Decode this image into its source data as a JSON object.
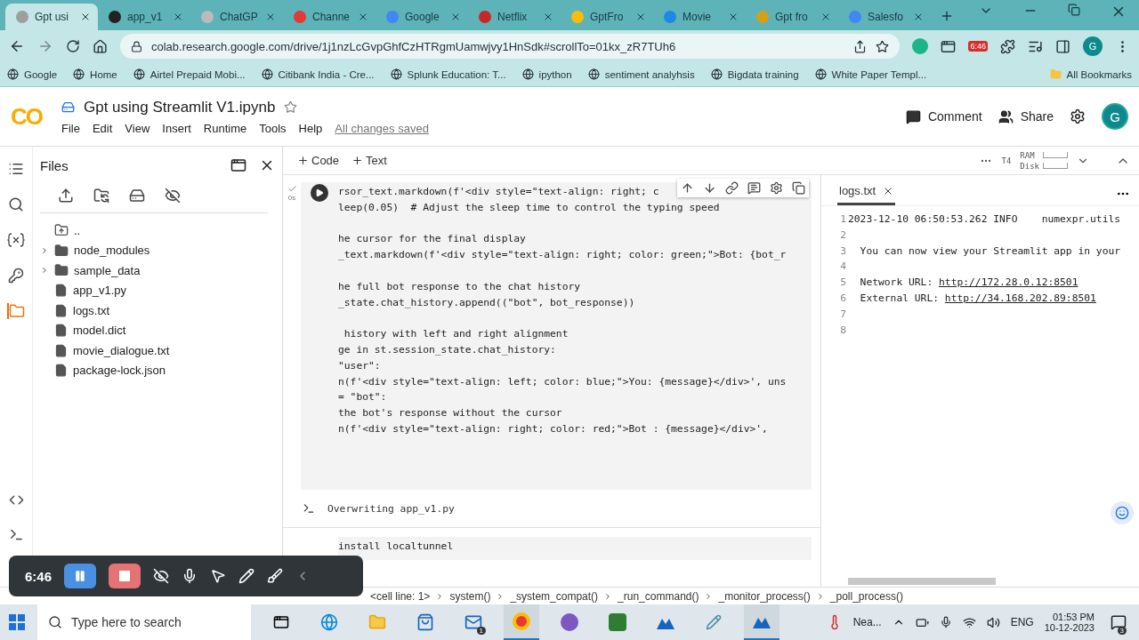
{
  "browser": {
    "tabs": [
      {
        "label": "Gpt usi",
        "selected": true
      },
      {
        "label": "app_v1",
        "selected": false
      },
      {
        "label": "ChatGP",
        "selected": false
      },
      {
        "label": "Channe",
        "selected": false
      },
      {
        "label": "Google",
        "selected": false
      },
      {
        "label": "Netflix",
        "selected": false
      },
      {
        "label": "GptFro",
        "selected": false
      },
      {
        "label": "Movie",
        "selected": false
      },
      {
        "label": "Gpt fro",
        "selected": false
      },
      {
        "label": "Salesfo",
        "selected": false
      }
    ],
    "address": "colab.research.google.com/drive/1j1nzLcGvpGhfCzHTRgmUamwjvy1HnSdk#scrollTo=01kx_zR7TUh6",
    "extension_badge": "6:46",
    "profile_initial": "G",
    "bookmarks": [
      "Google",
      "Home",
      "Airtel Prepaid Mobi...",
      "Citibank India - Cre...",
      "Splunk Education: T...",
      "ipython",
      "sentiment analyhsis",
      "Bigdata training",
      "White Paper Templ..."
    ],
    "all_bookmarks": "All Bookmarks"
  },
  "colab": {
    "logo": "CO",
    "title": "Gpt using Streamlit V1.ipynb",
    "menu": [
      "File",
      "Edit",
      "View",
      "Insert",
      "Runtime",
      "Tools",
      "Help"
    ],
    "save_status": "All changes saved",
    "comment": "Comment",
    "share": "Share",
    "avatar": "G"
  },
  "files_panel": {
    "title": "Files",
    "tree": [
      {
        "name": "..",
        "kind": "up"
      },
      {
        "name": "node_modules",
        "kind": "folder",
        "expanded": false
      },
      {
        "name": "sample_data",
        "kind": "folder",
        "expanded": false
      },
      {
        "name": "app_v1.py",
        "kind": "file"
      },
      {
        "name": "logs.txt",
        "kind": "file"
      },
      {
        "name": "model.dict",
        "kind": "file"
      },
      {
        "name": "movie_dialogue.txt",
        "kind": "file"
      },
      {
        "name": "package-lock.json",
        "kind": "file"
      }
    ]
  },
  "notebook": {
    "add_code": "Code",
    "add_text": "Text",
    "runtime": {
      "gpu": "T4",
      "ram": "RAM",
      "disk": "Disk"
    },
    "cells": [
      {
        "kind": "code",
        "status": "0s",
        "blocks": [
          [
            "rsor_text.markdown(f'<div style=\"text-align: right; c",
            "leep(0.05)  # Adjust the sleep time to control the typing speed"
          ],
          [
            "he cursor for the final display",
            "_text.markdown(f'<div style=\"text-align: right; color: green;\">Bot: {bot_r"
          ],
          [
            "he full bot response to the chat history",
            "_state.chat_history.append((\"bot\", bot_response))"
          ],
          [
            " history with left and right alignment",
            "ge in st.session_state.chat_history:",
            "\"user\":",
            "n(f'<div style=\"text-align: left; color: blue;\">You: {message}</div>', uns",
            "= \"bot\":",
            "the bot's response without the cursor",
            "n(f'<div style=\"text-align: right; color: red;\">Bot : {message}</div>',"
          ]
        ],
        "output": "Overwriting app_v1.py"
      },
      {
        "kind": "code",
        "blocks": [
          [
            "install localtunnel"
          ]
        ]
      }
    ]
  },
  "logs": {
    "tab": "logs.txt",
    "lines": [
      {
        "number": "1",
        "text": "2023-12-10 06:50:53.262 INFO    numexpr.utils"
      },
      {
        "number": "2"
      },
      {
        "number": "3",
        "text": "  You can now view your Streamlit app in your"
      },
      {
        "number": "4"
      },
      {
        "number": "5",
        "text": "  Network URL: ",
        "link": "http://172.28.0.12:8501"
      },
      {
        "number": "6",
        "text": "  External URL: ",
        "link": "http://34.168.202.89:8501"
      },
      {
        "number": "7"
      },
      {
        "number": "8"
      }
    ]
  },
  "status_bar": {
    "trace": [
      "<cell line: 1>",
      "system()",
      "_system_compat()",
      "_run_command()",
      "_monitor_process()",
      "_poll_process()"
    ]
  },
  "recorder": {
    "time": "6:46"
  },
  "taskbar": {
    "search_placeholder": "Type here to search",
    "mail_badge": "1",
    "weather": "Nea...",
    "language": "ENG",
    "time": "01:53 PM",
    "date": "10-12-2023",
    "notifications": "3"
  }
}
